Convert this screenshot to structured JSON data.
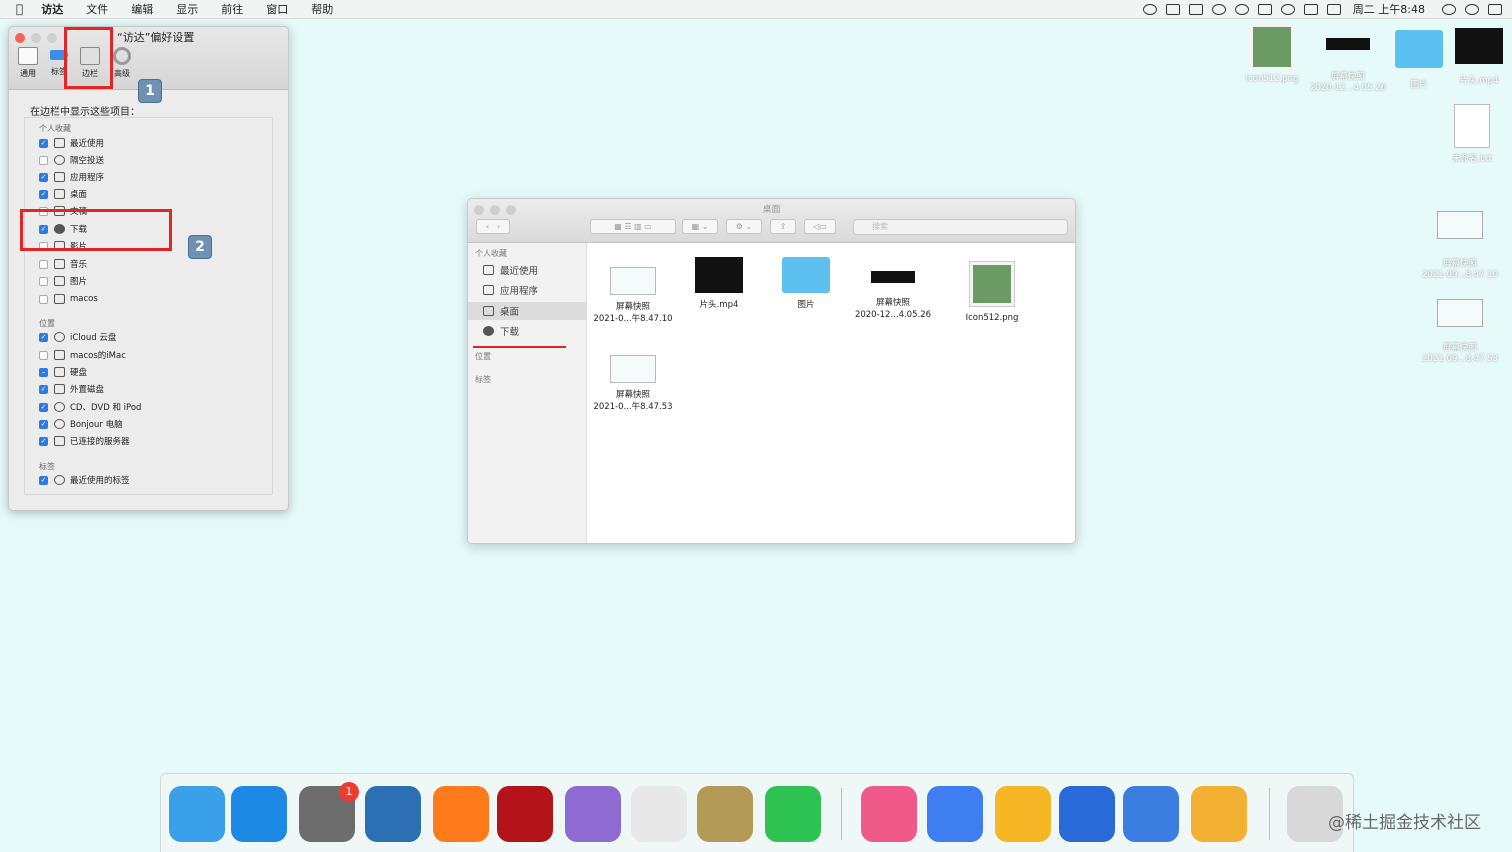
{
  "menubar": {
    "app_name": "访达",
    "menus": [
      "文件",
      "编辑",
      "显示",
      "前往",
      "窗口",
      "帮助"
    ],
    "clock": "周二 上午8:48",
    "status_icons": [
      "creative-cloud-icon",
      "window-icon",
      "shield-icon",
      "chat-icon",
      "wechat-icon",
      "s-icon",
      "sync-icon",
      "wifi-icon",
      "keyboard-icon",
      "search-icon",
      "siri-icon",
      "list-icon"
    ]
  },
  "prefs": {
    "title": "“访达”偏好设置",
    "tabs": [
      {
        "label": "通用",
        "icon": "general-icon"
      },
      {
        "label": "标签",
        "icon": "tag-icon"
      },
      {
        "label": "边栏",
        "icon": "sidebar-icon"
      },
      {
        "label": "高级",
        "icon": "gear-icon"
      }
    ],
    "heading": "在边栏中显示这些项目：",
    "badge1": "1",
    "badge2": "2",
    "favorites_label": "个人收藏",
    "favorites": [
      {
        "label": "最近使用",
        "checked": true
      },
      {
        "label": "隔空投送",
        "checked": false
      },
      {
        "label": "应用程序",
        "checked": true
      },
      {
        "label": "桌面",
        "checked": true
      },
      {
        "label": "文稿",
        "checked": false
      },
      {
        "label": "下载",
        "checked": true
      },
      {
        "label": "影片",
        "checked": false
      },
      {
        "label": "音乐",
        "checked": false
      },
      {
        "label": "图片",
        "checked": false
      },
      {
        "label": "macos",
        "checked": false
      }
    ],
    "locations_label": "位置",
    "locations": [
      {
        "label": "iCloud 云盘",
        "checked": true
      },
      {
        "label": "macos的iMac",
        "checked": false
      },
      {
        "label": "硬盘",
        "checked": "partial"
      },
      {
        "label": "外置磁盘",
        "checked": true
      },
      {
        "label": "CD、DVD 和 iPod",
        "checked": true
      },
      {
        "label": "Bonjour 电脑",
        "checked": true
      },
      {
        "label": "已连接的服务器",
        "checked": true
      }
    ],
    "tags_label": "标签",
    "tags": [
      {
        "label": "最近使用的标签",
        "checked": true
      }
    ]
  },
  "finder": {
    "title": "桌面",
    "search_placeholder": "搜索",
    "favorites_label": "个人收藏",
    "sidebar": [
      {
        "label": "最近使用",
        "icon": "recents-icon"
      },
      {
        "label": "应用程序",
        "icon": "applications-icon"
      },
      {
        "label": "桌面",
        "icon": "desktop-icon",
        "selected": true
      },
      {
        "label": "下载",
        "icon": "download-icon"
      }
    ],
    "locations_label": "位置",
    "tags_label": "标签",
    "files": [
      {
        "name": "屏幕快照",
        "sub": "2021-0...午8.47.10",
        "kind": "shot"
      },
      {
        "name": "片头.mp4",
        "sub": "",
        "kind": "video"
      },
      {
        "name": "图片",
        "sub": "",
        "kind": "folder"
      },
      {
        "name": "屏幕快照",
        "sub": "2020-12...4.05.26",
        "kind": "bar"
      },
      {
        "name": "Icon512.png",
        "sub": "",
        "kind": "png"
      },
      {
        "name": "屏幕快照",
        "sub": "2021-0...午8.47.53",
        "kind": "shot"
      }
    ]
  },
  "desktop": {
    "icons": [
      {
        "name": "Icon512.png",
        "sub": "",
        "kind": "png"
      },
      {
        "name": "屏幕快照",
        "sub": "2020-12...4.05.26",
        "kind": "bar"
      },
      {
        "name": "图片",
        "sub": "",
        "kind": "folder"
      },
      {
        "name": "片头.mp4",
        "sub": "",
        "kind": "video"
      },
      {
        "name": "未命名.txt",
        "sub": "",
        "kind": "txt"
      },
      {
        "name": "屏幕快照",
        "sub": "2021-09...8.47.10",
        "kind": "shot"
      },
      {
        "name": "屏幕快照",
        "sub": "2021-09...8.47.53",
        "kind": "shot"
      }
    ]
  },
  "dock": {
    "apps": [
      "finder-icon",
      "qq-browser-icon",
      "system-preferences-icon",
      "xcode-icon",
      "firefox-icon",
      "filezilla-icon",
      "downloader-icon",
      "chrome-icon",
      "notebook-icon",
      "wechat-icon",
      "itunes-icon",
      "baidu-netdisk-icon",
      "sketch-icon",
      "word-icon",
      "s-app-icon",
      "preview-app-icon",
      "trash-icon"
    ],
    "colors": [
      "#3aa0ea",
      "#1e88e5",
      "#6d6d6d",
      "#2d6fb3",
      "#ff7a1a",
      "#b5131a",
      "#8e6ad3",
      "#e8e8e8",
      "#b39a56",
      "#2dc251",
      "#f05a8a",
      "#3f7ef0",
      "#f6b626",
      "#2a6ad8",
      "#3c7ee0",
      "#f2b132",
      "#d8d8d8"
    ],
    "system_badge": "1"
  },
  "watermark": "@稀土掘金技术社区"
}
